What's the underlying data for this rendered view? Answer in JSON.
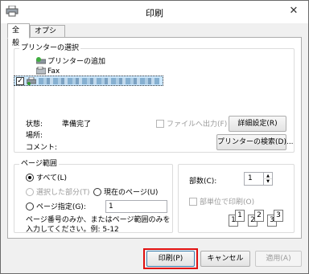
{
  "window": {
    "title": "印刷",
    "close_glyph": "✕"
  },
  "tabs": [
    {
      "label": "全般",
      "active": true
    },
    {
      "label": "オプション",
      "active": false
    }
  ],
  "printer_group": {
    "label": "プリンターの選択",
    "items": [
      {
        "label": "プリンターの追加",
        "icon": "add-printer-icon"
      },
      {
        "label": "Fax",
        "icon": "fax-icon"
      },
      {
        "label": "",
        "icon": "printer-icon",
        "checked": true,
        "selected": true
      }
    ],
    "status_label": "状態:",
    "status_value": "準備完了",
    "location_label": "場所:",
    "comment_label": "コメント:",
    "print_to_file_label": "ファイルへ出力(F)",
    "advanced_button": "詳細設定(R)",
    "find_printer_button": "プリンターの検索(D)..."
  },
  "page_range": {
    "label": "ページ範囲",
    "all_label": "すべて(L)",
    "selection_label": "選択した部分(T)",
    "current_page_label": "現在のページ(U)",
    "pages_label": "ページ指定(G):",
    "pages_value": "1",
    "hint": "ページ番号のみか、またはページ範囲のみを入力してください。例: 5-12"
  },
  "copies": {
    "label": "部数(C):",
    "value": "1",
    "collate_label": "部単位で印刷(O)",
    "collate_numbers": [
      "1",
      "1",
      "2",
      "2",
      "3",
      "3"
    ]
  },
  "footer": {
    "print_button": "印刷(P)",
    "cancel_button": "キャンセル",
    "apply_button": "適用(A)"
  },
  "colors": {
    "highlight": "#e01010",
    "selection": "#cce8ff"
  }
}
